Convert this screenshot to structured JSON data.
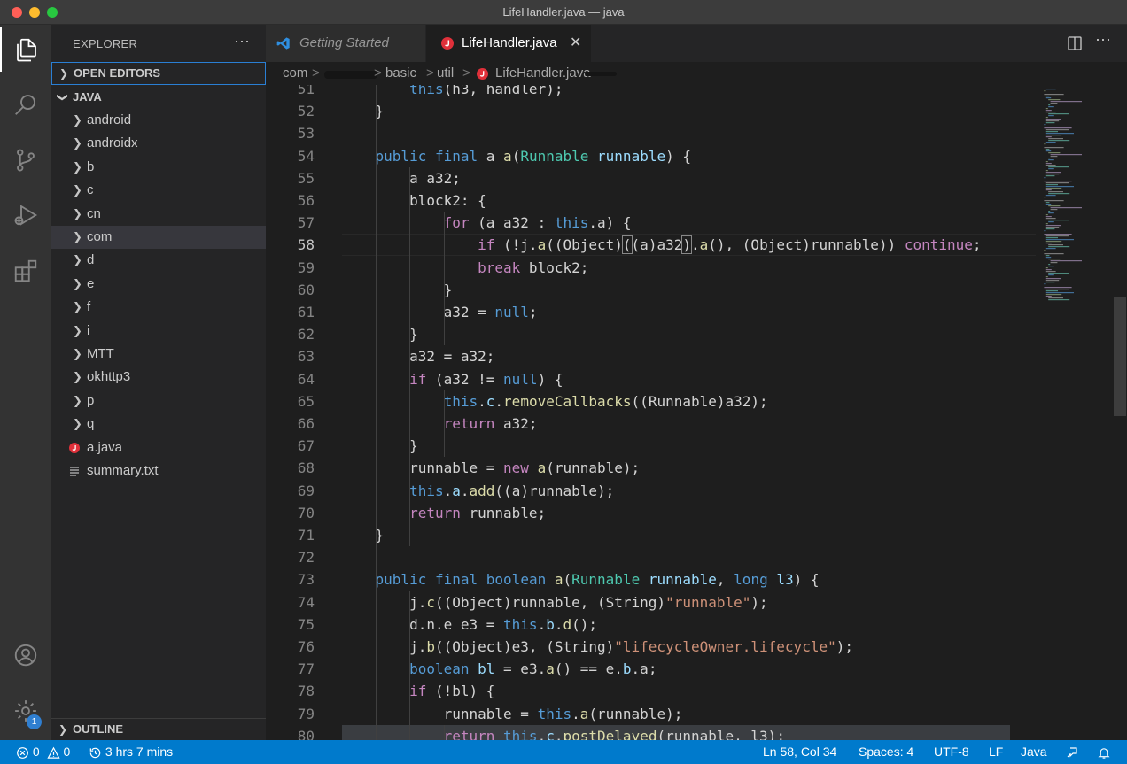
{
  "window": {
    "title": "LifeHandler.java — java"
  },
  "activity_bar": {
    "items": [
      "explorer-icon",
      "search-icon",
      "source-control-icon",
      "run-debug-icon",
      "extensions-icon",
      "accounts-icon",
      "manage-gear-icon"
    ],
    "manage_badge": "1"
  },
  "sidebar": {
    "title": "EXPLORER",
    "more": "···",
    "open_editors": "OPEN EDITORS",
    "root_folder": "JAVA",
    "tree": [
      {
        "label": "android",
        "kind": "folder"
      },
      {
        "label": "androidx",
        "kind": "folder"
      },
      {
        "label": "b",
        "kind": "folder"
      },
      {
        "label": "c",
        "kind": "folder"
      },
      {
        "label": "cn",
        "kind": "folder"
      },
      {
        "label": "com",
        "kind": "folder",
        "selected": true
      },
      {
        "label": "d",
        "kind": "folder"
      },
      {
        "label": "e",
        "kind": "folder"
      },
      {
        "label": "f",
        "kind": "folder"
      },
      {
        "label": "i",
        "kind": "folder"
      },
      {
        "label": "MTT",
        "kind": "folder"
      },
      {
        "label": "okhttp3",
        "kind": "folder"
      },
      {
        "label": "p",
        "kind": "folder"
      },
      {
        "label": "q",
        "kind": "folder"
      },
      {
        "label": "a.java",
        "kind": "java-file"
      },
      {
        "label": "summary.txt",
        "kind": "text-file"
      }
    ],
    "outline": "OUTLINE"
  },
  "tabs": [
    {
      "label": "Getting Started",
      "active": false,
      "icon": "vscode-icon"
    },
    {
      "label": "LifeHandler.java",
      "active": true,
      "icon": "java-file-icon",
      "close": "✕"
    }
  ],
  "tabs_more": "···",
  "breadcrumb": {
    "segments": [
      "com",
      "basic",
      "util",
      "LifeHandler.java"
    ],
    "separator": ">"
  },
  "editor": {
    "current_line": 58,
    "lines": [
      {
        "n": "51",
        "text": "        this(h3, handler);"
      },
      {
        "n": "52",
        "text": "    }"
      },
      {
        "n": "53",
        "text": ""
      },
      {
        "n": "54",
        "text": "    public final a a(Runnable runnable) {"
      },
      {
        "n": "55",
        "text": "        a a32;"
      },
      {
        "n": "56",
        "text": "        block2: {"
      },
      {
        "n": "57",
        "text": "            for (a a32 : this.a) {"
      },
      {
        "n": "58",
        "text": "                if (!j.a((Object)((a)a32).a(), (Object)runnable)) continue;"
      },
      {
        "n": "59",
        "text": "                break block2;"
      },
      {
        "n": "60",
        "text": "            }"
      },
      {
        "n": "61",
        "text": "            a32 = null;"
      },
      {
        "n": "62",
        "text": "        }"
      },
      {
        "n": "63",
        "text": "        a32 = a32;"
      },
      {
        "n": "64",
        "text": "        if (a32 != null) {"
      },
      {
        "n": "65",
        "text": "            this.c.removeCallbacks((Runnable)a32);"
      },
      {
        "n": "66",
        "text": "            return a32;"
      },
      {
        "n": "67",
        "text": "        }"
      },
      {
        "n": "68",
        "text": "        runnable = new a(runnable);"
      },
      {
        "n": "69",
        "text": "        this.a.add((a)runnable);"
      },
      {
        "n": "70",
        "text": "        return runnable;"
      },
      {
        "n": "71",
        "text": "    }"
      },
      {
        "n": "72",
        "text": ""
      },
      {
        "n": "73",
        "text": "    public final boolean a(Runnable runnable, long l3) {"
      },
      {
        "n": "74",
        "text": "        j.c((Object)runnable, (String)\"runnable\");"
      },
      {
        "n": "75",
        "text": "        d.n.e e3 = this.b.d();"
      },
      {
        "n": "76",
        "text": "        j.b((Object)e3, (String)\"lifecycleOwner.lifecycle\");"
      },
      {
        "n": "77",
        "text": "        boolean bl = e3.a() == e.b.a;"
      },
      {
        "n": "78",
        "text": "        if (!bl) {"
      },
      {
        "n": "79",
        "text": "            runnable = this.a(runnable);"
      },
      {
        "n": "80",
        "text": "            return this.c.postDelayed(runnable, l3);"
      }
    ]
  },
  "status_bar": {
    "errors": "0",
    "warnings": "0",
    "time": "3 hrs 7 mins",
    "position": "Ln 58, Col 34",
    "spaces": "Spaces: 4",
    "encoding": "UTF-8",
    "eol": "LF",
    "language": "Java"
  },
  "colors": {
    "accent": "#007acc",
    "keyword": "#569cd6",
    "control": "#c586c0",
    "type": "#4ec9b0",
    "function": "#dcdcaa",
    "variable": "#9cdcfe",
    "string": "#ce9178",
    "java_icon": "#e0303a"
  }
}
